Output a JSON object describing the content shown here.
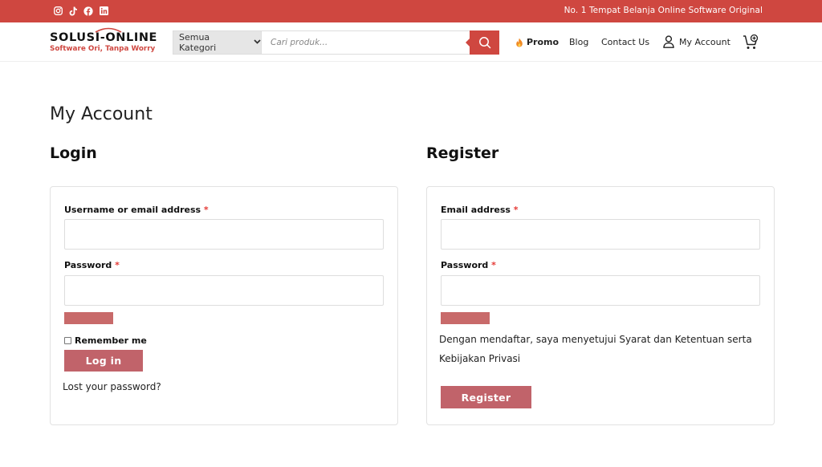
{
  "topbar": {
    "socials": [
      "instagram-icon",
      "tiktok-icon",
      "facebook-icon",
      "linkedin-icon"
    ],
    "tagline": "No. 1 Tempat Belanja Online Software Original"
  },
  "logo": {
    "main": "SOLUSI-ONLINE",
    "sub": "Software Ori, Tanpa Worry"
  },
  "search": {
    "category": "Semua Kategori",
    "placeholder": "Cari produk..."
  },
  "nav": {
    "promo": "Promo",
    "blog": "Blog",
    "contact": "Contact Us",
    "account": "My Account"
  },
  "page": {
    "title": "My Account"
  },
  "login": {
    "heading": "Login",
    "username_label": "Username or email address",
    "password_label": "Password",
    "required_mark": "*",
    "remember_label": "Remember me",
    "submit": "Log in",
    "lost_password": "Lost your password?"
  },
  "register": {
    "heading": "Register",
    "email_label": "Email address",
    "password_label": "Password",
    "required_mark": "*",
    "terms": "Dengan mendaftar, saya menyetujui Syarat dan Ketentuan serta Kebijakan Privasi",
    "submit": "Register"
  },
  "colors": {
    "brand_red": "#cf4740",
    "button_red": "#c1636a"
  }
}
